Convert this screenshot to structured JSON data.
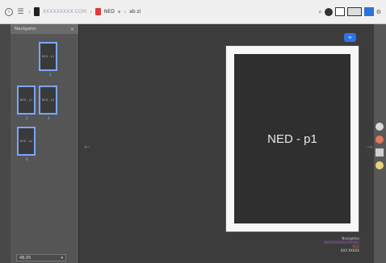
{
  "topbar": {
    "breadcrumb_domain": "XXXXXXXXX.COM",
    "breadcrumb_project": "NED",
    "breadcrumb_sep1": "›",
    "breadcrumb_sep2": "›",
    "breadcrumb_current": "ab zi"
  },
  "navigator": {
    "title": "Navigator",
    "close": "×",
    "footer_value": "48,05",
    "footer_caret": "▾",
    "thumbs": [
      {
        "label": "NED - p1",
        "num": "1"
      },
      {
        "label": "NED - p2",
        "num": "2"
      },
      {
        "label": "NED - p3",
        "num": "3"
      },
      {
        "label": "NED - p4",
        "num": "4"
      }
    ]
  },
  "canvas": {
    "page_title": "NED - p1",
    "badge": "∞",
    "arrow_left": "←",
    "arrow_right": "→"
  },
  "info": {
    "line1": "Navigation",
    "line2": "XXXXXXXXXXXXXXXX",
    "line3": "NED",
    "line4": "XXX XXXXX"
  },
  "colors": {
    "accent": "#2e74e6",
    "thumb_border": "#7aa6ff",
    "red": "#e03a3a"
  },
  "icons": {
    "back": "circle-back-icon",
    "menu": "grid-icon",
    "device": "phone-icon",
    "project": "red-doc-icon",
    "search": "search-icon",
    "settings": "gear-icon"
  }
}
